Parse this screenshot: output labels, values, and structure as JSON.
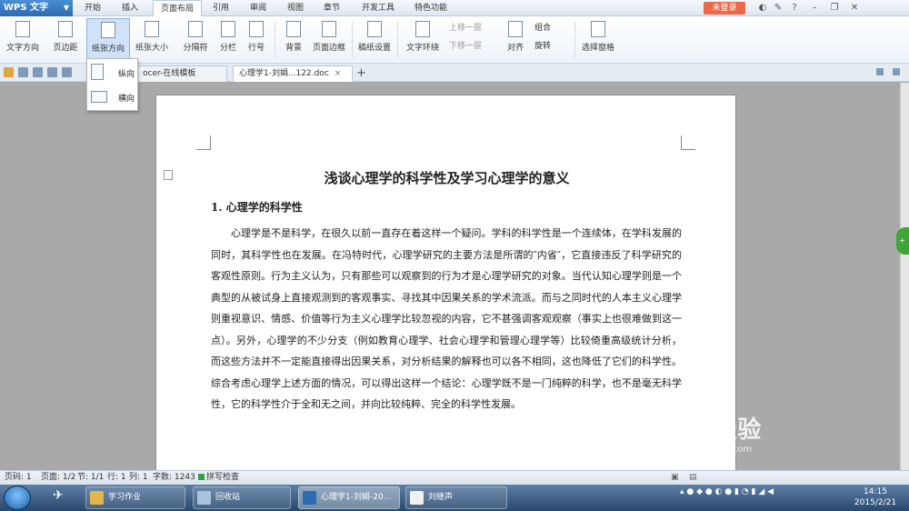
{
  "app": {
    "name": "WPS 文字",
    "login": "未登录"
  },
  "menus": [
    "开始",
    "插入",
    "页面布局",
    "引用",
    "审阅",
    "视图",
    "章节",
    "开发工具",
    "特色功能"
  ],
  "ribbon": {
    "text_direction": "文字方向",
    "margins": "页边距",
    "orientation": "纸张方向",
    "size": "纸张大小",
    "separator": "分隔符",
    "columns": "分栏",
    "line_numbers": "行号",
    "background": "背景",
    "page_border": "页面边框",
    "draft_settings": "稿纸设置",
    "text_wrap": "文字环绕",
    "bring_forward": "上移一层",
    "send_backward": "下移一层",
    "align": "对齐",
    "group": "组合",
    "rotate": "旋转",
    "select_pane": "选择窗格"
  },
  "orientation_menu": {
    "portrait": "纵向",
    "landscape": "横向"
  },
  "tabs": [
    {
      "label": "ocer-在线模板"
    },
    {
      "label": "心理学1-刘娟...122.doc"
    }
  ],
  "document": {
    "title": "浅谈心理学的科学性及学习心理学的意义",
    "heading": "1. 心理学的科学性",
    "paragraph": "心理学是不是科学，在很久以前一直存在着这样一个疑问。学科的科学性是一个连续体，在学科发展的同时，其科学性也在发展。在冯特时代，心理学研究的主要方法是所谓的″内省″，它直接违反了科学研究的客观性原则。行为主义认为，只有那些可以观察到的行为才是心理学研究的对象。当代认知心理学则是一个典型的从被试身上直接观测到的客观事实、寻找其中因果关系的学术流派。而与之同时代的人本主义心理学则重视意识、情感、价值等行为主义心理学比较忽视的内容，它不甚强调客观观察（事实上也很难做到这一点）。另外，心理学的不少分支（例如教育心理学、社会心理学和管理心理学等）比较倚重高级统计分析，而这些方法并不一定能直接得出因果关系，对分析结果的解释也可以各不相同，这也降低了它们的科学性。综合考虑心理学上述方面的情况，可以得出这样一个结论：心理学既不是一门纯粹的科学，也不是毫无科学性，它的科学性介于全和无之间，并向比较纯粹、完全的科学性发展。"
  },
  "status": {
    "page": "页码: 1",
    "pages": "页面: 1/2",
    "section": "节: 1/1",
    "row": "行: 1",
    "col": "列: 1",
    "words": "字数: 1243",
    "spell": "拼写检查"
  },
  "taskbar": {
    "items": [
      "学习作业",
      "回收站",
      "心理学1-刘娟-20...",
      "刘继声"
    ],
    "time": "14:15",
    "date": "2015/2/21"
  },
  "watermark": {
    "brand": "Bai经验",
    "url": "jingyan.baidu.com"
  }
}
